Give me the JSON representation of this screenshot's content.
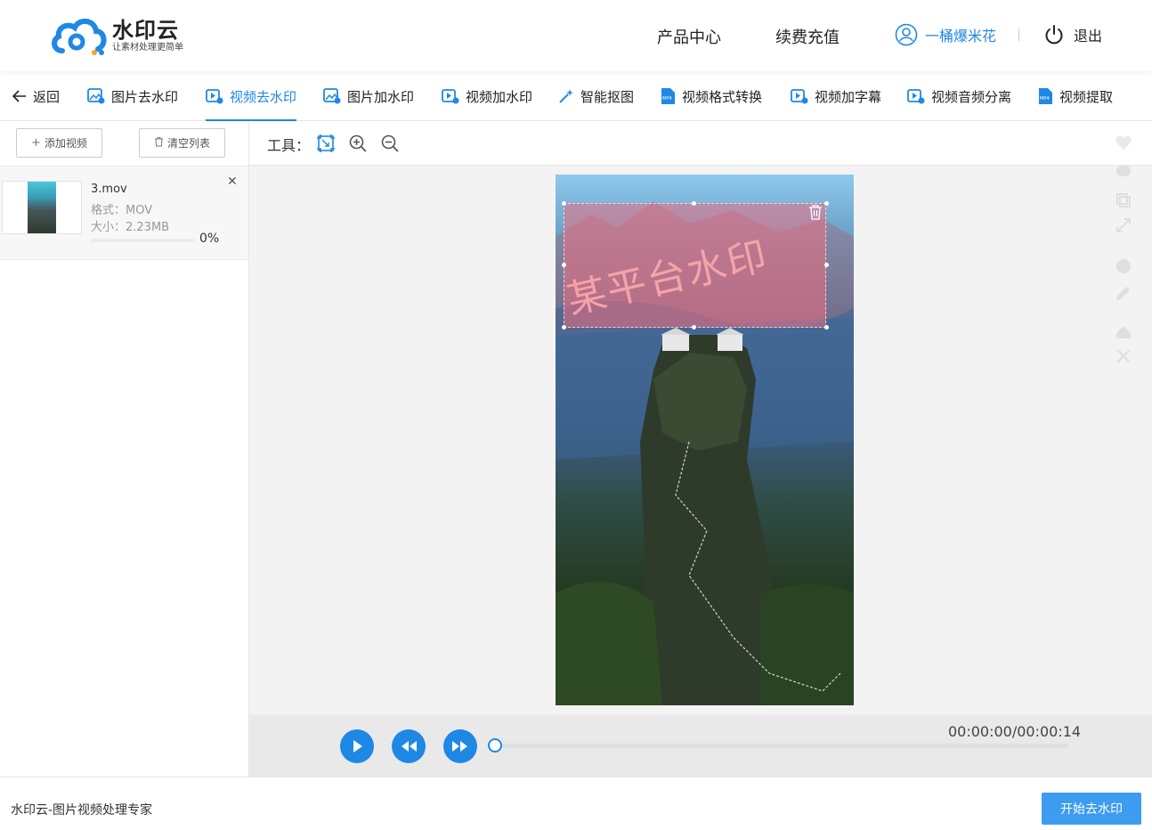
{
  "header": {
    "logo_name": "水印云",
    "logo_slogan": "让素材处理更简单",
    "nav_products": "产品中心",
    "nav_recharge": "续费充值",
    "username": "一桶爆米花",
    "logout": "退出"
  },
  "toolbar": {
    "back": "返回",
    "items": [
      {
        "label": "图片去水印",
        "icon": "image-remove-watermark-icon"
      },
      {
        "label": "视频去水印",
        "icon": "video-remove-watermark-icon",
        "active": true
      },
      {
        "label": "图片加水印",
        "icon": "image-add-watermark-icon"
      },
      {
        "label": "视频加水印",
        "icon": "video-add-watermark-icon"
      },
      {
        "label": "智能抠图",
        "icon": "magic-wand-icon"
      },
      {
        "label": "视频格式转换",
        "icon": "mp4-file-icon"
      },
      {
        "label": "视频加字幕",
        "icon": "video-subtitle-icon"
      },
      {
        "label": "视频音频分离",
        "icon": "video-audio-split-icon"
      },
      {
        "label": "视频提取",
        "icon": "mp4-file-icon"
      }
    ]
  },
  "sidebar": {
    "add_video": "添加视频",
    "clear_list": "清空列表",
    "file": {
      "name": "3.mov",
      "format": "格式：MOV",
      "size": "大小：2.23MB",
      "progress": 0,
      "progress_text": "0%"
    }
  },
  "editor": {
    "tools_label": "工具：",
    "watermark_text": "某平台水印"
  },
  "player": {
    "timecode": "00:00:00/00:00:14",
    "position": 0
  },
  "footer": {
    "text": "水印云-图片视频处理专家",
    "start_button": "开始去水印"
  },
  "colors": {
    "accent": "#1e88e5",
    "start_button": "#3d9bf0",
    "watermark_box": "rgba(236,110,130,0.55)"
  }
}
